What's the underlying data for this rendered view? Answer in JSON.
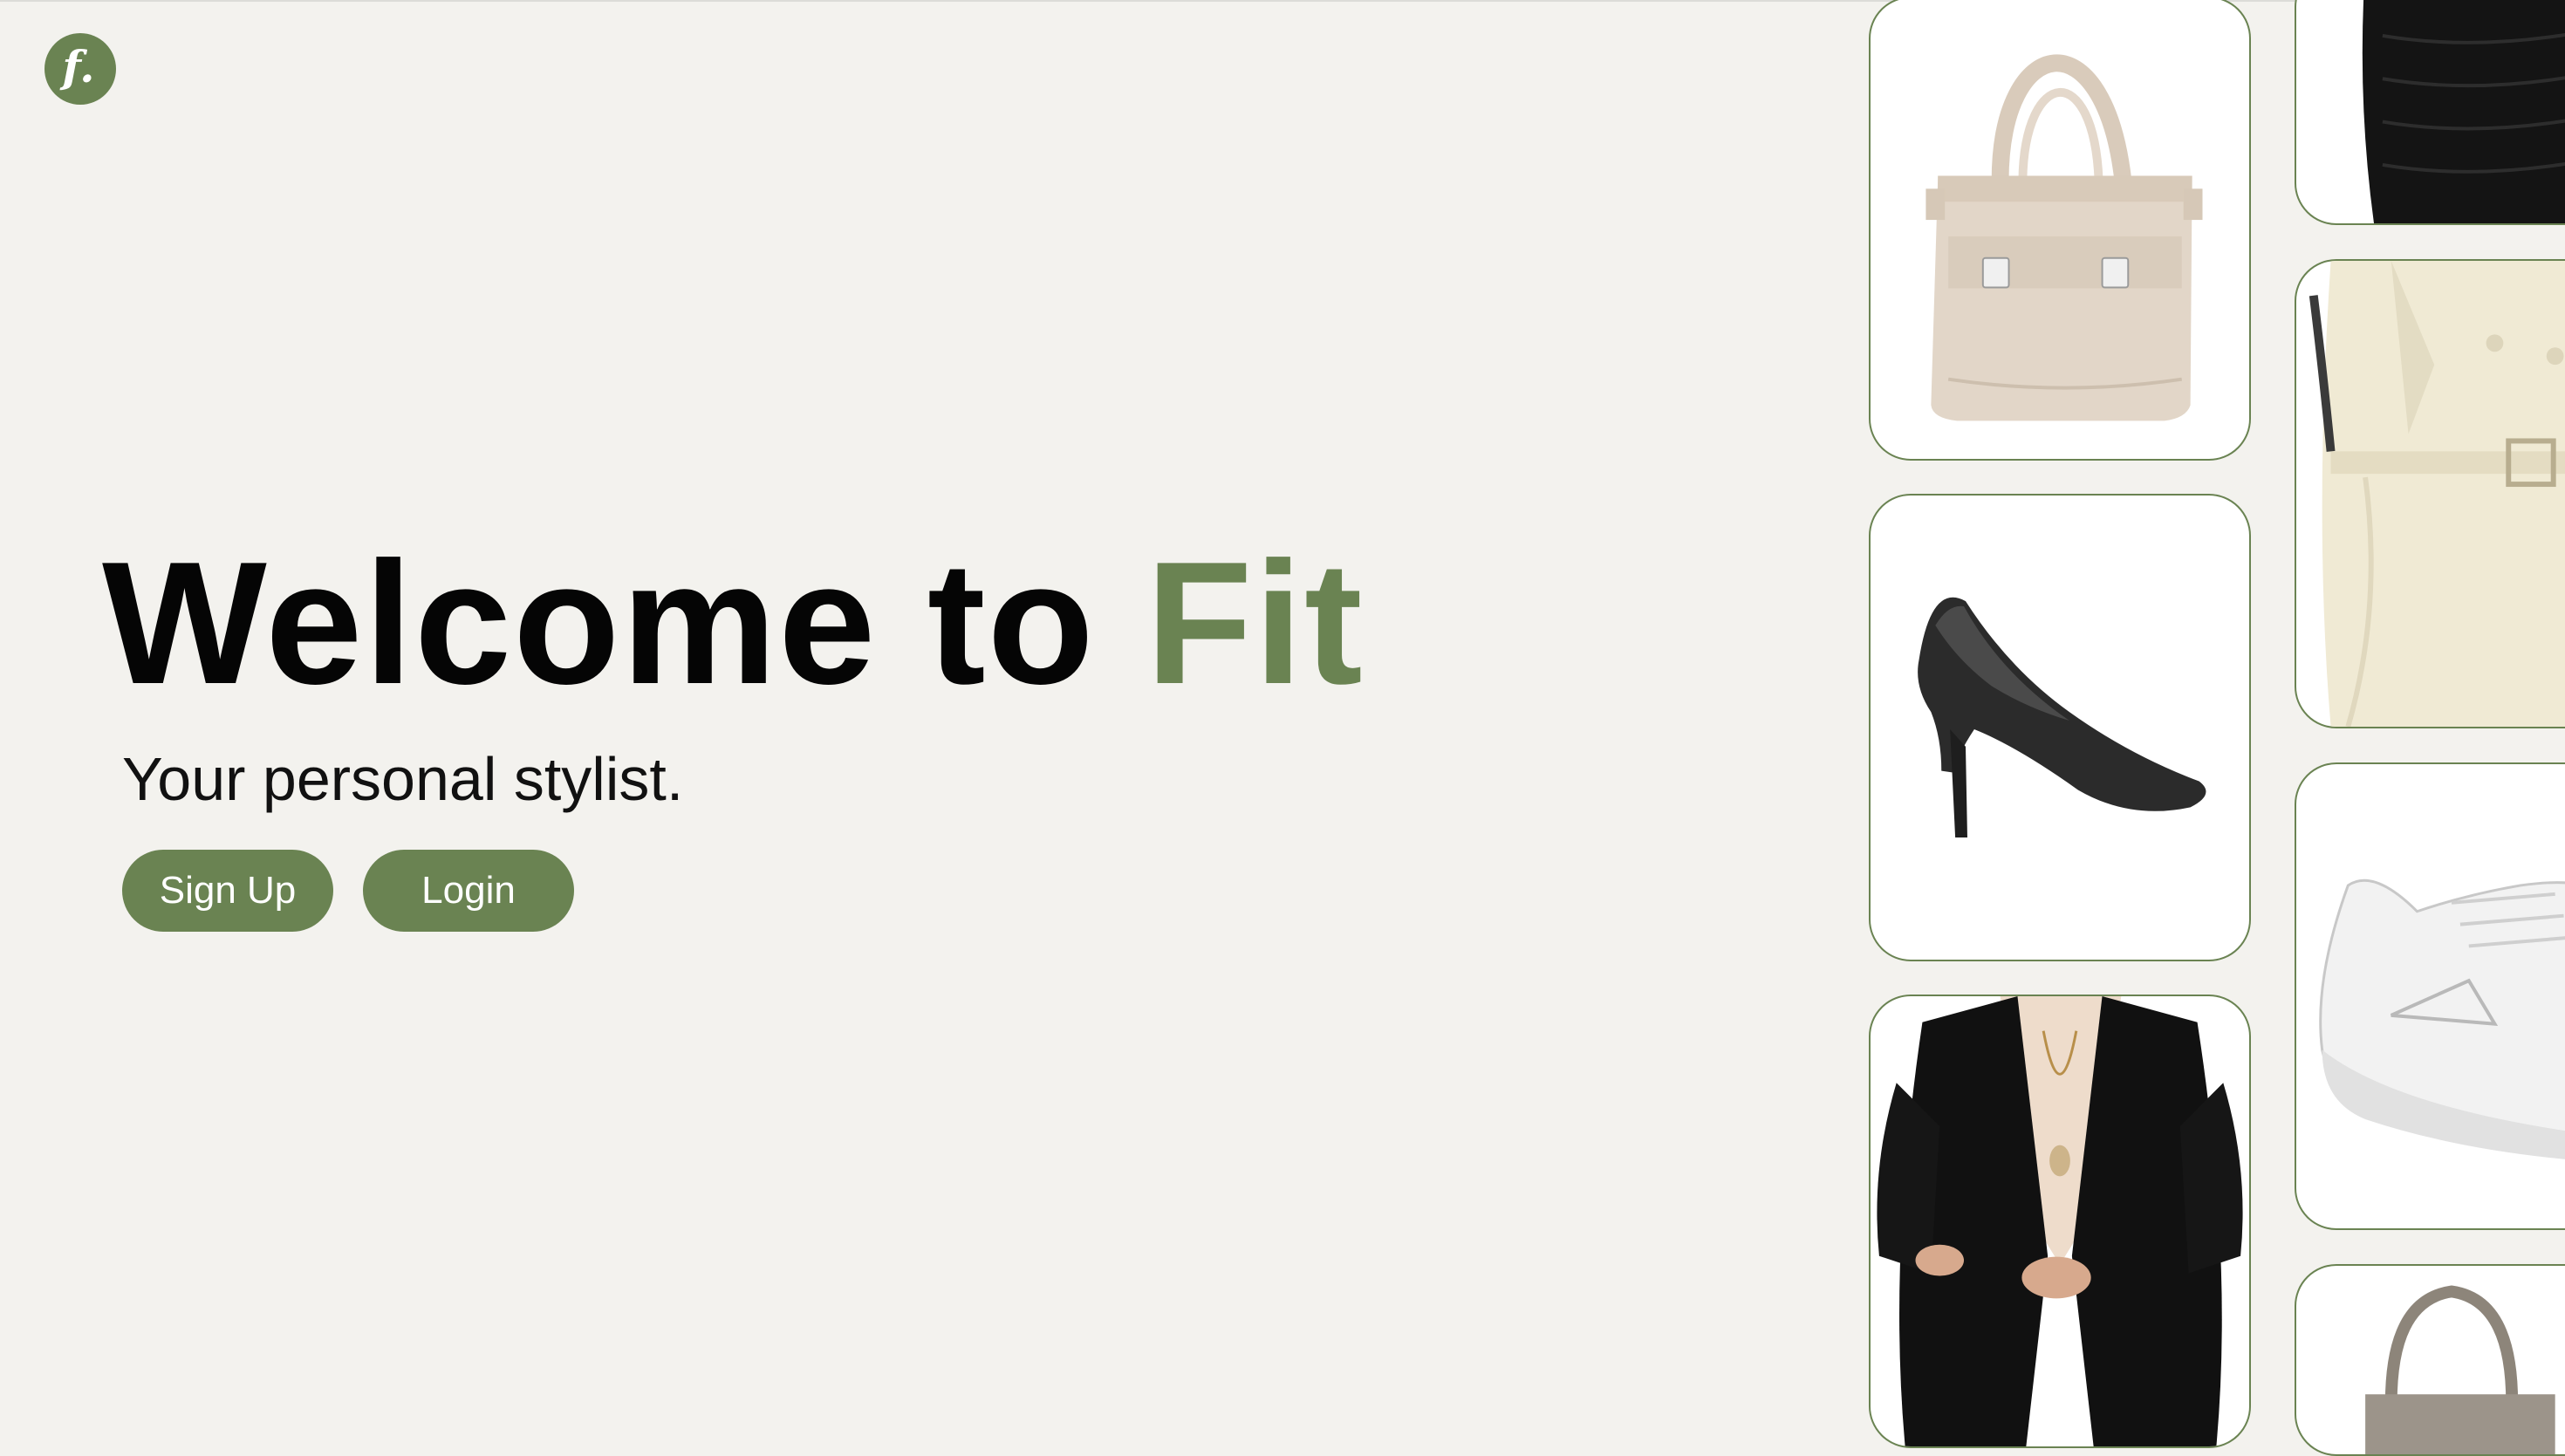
{
  "app": {
    "logo_letter": "f.",
    "brand_color": "#6a8352",
    "background_color": "#f3f2ee"
  },
  "hero": {
    "title_prefix": "Welcome to ",
    "title_accent": "Fit",
    "tagline": "Your personal stylist."
  },
  "actions": {
    "signup_label": "Sign Up",
    "login_label": "Login"
  },
  "gallery": {
    "items": [
      {
        "icon": "handbag-icon",
        "description_visible": false
      },
      {
        "icon": "high-heel-icon",
        "description_visible": false
      },
      {
        "icon": "blazer-icon",
        "description_visible": false
      },
      {
        "icon": "black-top-icon",
        "description_visible": false
      },
      {
        "icon": "trench-coat-icon",
        "description_visible": false
      },
      {
        "icon": "sneaker-icon",
        "description_visible": false
      },
      {
        "icon": "grey-bag-icon",
        "description_visible": false
      }
    ]
  }
}
